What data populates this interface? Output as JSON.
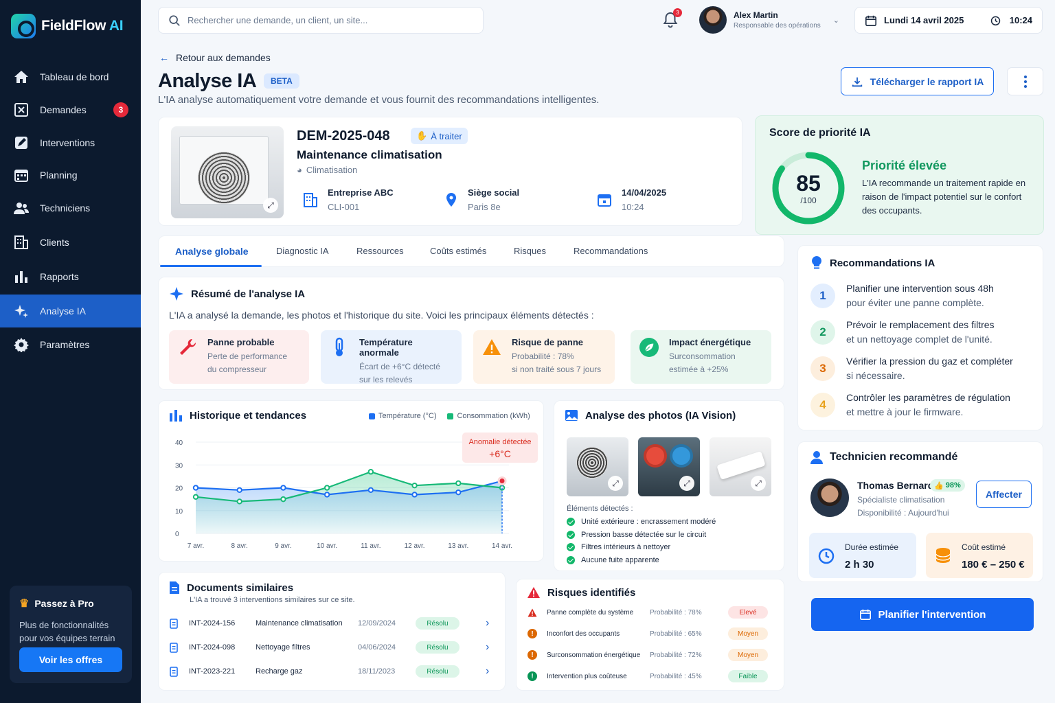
{
  "app": {
    "name_main": "FieldFlow",
    "name_accent": "AI"
  },
  "sidebar": {
    "items": [
      {
        "label": "Tableau de bord",
        "icon": "home-icon"
      },
      {
        "label": "Demandes",
        "icon": "requests-icon",
        "badge": "3"
      },
      {
        "label": "Interventions",
        "icon": "edit-icon"
      },
      {
        "label": "Planning",
        "icon": "calendar-icon"
      },
      {
        "label": "Techniciens",
        "icon": "users-icon"
      },
      {
        "label": "Clients",
        "icon": "building-icon"
      },
      {
        "label": "Rapports",
        "icon": "bar-chart-icon"
      },
      {
        "label": "Analyse IA",
        "icon": "sparkles-icon",
        "active": true
      },
      {
        "label": "Paramètres",
        "icon": "gear-icon"
      }
    ],
    "promo": {
      "title": "Passez à Pro",
      "text": "Plus de fonctionnalités pour vos équipes terrain",
      "button": "Voir les offres"
    }
  },
  "topbar": {
    "search_placeholder": "Rechercher une demande, un client, un site...",
    "notif_count": "3",
    "user_name": "Alex Martin",
    "user_role": "Responsable des opérations",
    "date": "Lundi 14 avril 2025",
    "time": "10:24"
  },
  "header": {
    "back": "Retour aux demandes",
    "title": "Analyse IA",
    "badge": "BETA",
    "subtitle": "L'IA analyse automatiquement votre demande et vous fournit des recommandations intelligentes.",
    "download": "Télécharger le rapport IA"
  },
  "request": {
    "id": "DEM-2025-048",
    "status": "À traiter",
    "name": "Maintenance climatisation",
    "category": "Climatisation",
    "client": "Entreprise ABC",
    "client_id": "CLI-001",
    "site": "Siège social",
    "site_city": "Paris 8e",
    "date": "14/04/2025",
    "time": "10:24"
  },
  "score": {
    "title": "Score de priorité IA",
    "value": "85",
    "max": "/100",
    "fraction": 0.85,
    "level": "Priorité élevée",
    "text": "L'IA recommande un traitement rapide en raison de l'impact potentiel sur le confort des occupants.",
    "color": "#12b76a"
  },
  "tabs": [
    "Analyse globale",
    "Diagnostic IA",
    "Ressources",
    "Coûts estimés",
    "Risques",
    "Recommandations"
  ],
  "summary": {
    "title": "Résumé de l'analyse IA",
    "text": "L'IA a analysé la demande, les photos et l'historique du site. Voici les principaux éléments détectés :",
    "items": [
      {
        "title": "Panne probable",
        "desc1": "Perte de performance",
        "desc2": "du compresseur",
        "color": "#fdeeee"
      },
      {
        "title": "Température anormale",
        "desc1": "Écart de +6°C détecté",
        "desc2": "sur les relevés",
        "color": "#eaf2fd"
      },
      {
        "title": "Risque de panne",
        "desc1": "Probabilité : 78%",
        "desc2": "si non traité sous 7 jours",
        "color": "#fef3e8"
      },
      {
        "title": "Impact énergétique",
        "desc1": "Surconsommation",
        "desc2": "estimée à +25%",
        "color": "#eaf7f0"
      }
    ]
  },
  "history": {
    "title": "Historique et tendances",
    "legend_temp": "Température (°C)",
    "legend_conso": "Consommation (kWh)",
    "anomaly_label": "Anomalie détectée",
    "anomaly_value": "+6°C"
  },
  "chart_data": {
    "type": "line",
    "categories": [
      "7 avr.",
      "8 avr.",
      "9 avr.",
      "10 avr.",
      "11 avr.",
      "12 avr.",
      "13 avr.",
      "14 avr."
    ],
    "yticks": [
      "0",
      "10",
      "20",
      "30",
      "40"
    ],
    "ylim": [
      0,
      40
    ],
    "series": [
      {
        "name": "Température (°C)",
        "values": [
          20,
          19,
          20,
          17,
          19,
          17,
          18,
          23
        ],
        "color": "#1d6ff2"
      },
      {
        "name": "Consommation (kWh)",
        "values": [
          16,
          14,
          15,
          20,
          27,
          21,
          22,
          20
        ],
        "color": "#17b978"
      }
    ],
    "annotation": {
      "x": "14 avr.",
      "text": "Anomalie détectée +6°C"
    }
  },
  "photos": {
    "title": "Analyse des photos (IA Vision)",
    "elements_title": "Éléments détectés :",
    "elements": [
      "Unité extérieure : encrassement modéré",
      "Pression basse détectée sur le circuit",
      "Filtres intérieurs à nettoyer",
      "Aucune fuite apparente"
    ]
  },
  "documents": {
    "title": "Documents similaires",
    "subtitle": "L'IA a trouvé 3 interventions similaires sur ce site.",
    "rows": [
      {
        "id": "INT-2024-156",
        "label": "Maintenance climatisation",
        "date": "12/09/2024",
        "status": "Résolu"
      },
      {
        "id": "INT-2024-098",
        "label": "Nettoyage filtres",
        "date": "04/06/2024",
        "status": "Résolu"
      },
      {
        "id": "INT-2023-221",
        "label": "Recharge gaz",
        "date": "18/11/2023",
        "status": "Résolu"
      }
    ]
  },
  "risks": {
    "title": "Risques identifiés",
    "rows": [
      {
        "label": "Panne complète du système",
        "prob": "Probabilité : 78%",
        "level": "Elevé",
        "bg": "#fde4e4",
        "fg": "#d92d20"
      },
      {
        "label": "Inconfort des occupants",
        "prob": "Probabilité : 65%",
        "level": "Moyen",
        "bg": "#fdeedd",
        "fg": "#dc6803"
      },
      {
        "label": "Surconsommation énergétique",
        "prob": "Probabilité : 72%",
        "level": "Moyen",
        "bg": "#fdeedd",
        "fg": "#dc6803"
      },
      {
        "label": "Intervention plus coûteuse",
        "prob": "Probabilité : 45%",
        "level": "Faible",
        "bg": "#dcf5e8",
        "fg": "#079455"
      }
    ]
  },
  "recommendations": {
    "title": "Recommandations IA",
    "items": [
      {
        "num": "1",
        "l1": "Planifier une intervention sous 48h",
        "l2": "pour éviter une panne complète.",
        "bg": "#e3eefe",
        "fg": "#1d5fc7"
      },
      {
        "num": "2",
        "l1": "Prévoir le remplacement des filtres",
        "l2": "et un nettoyage complet de l'unité.",
        "bg": "#dff5ea",
        "fg": "#12985f"
      },
      {
        "num": "3",
        "l1": "Vérifier la pression du gaz et compléter",
        "l2": "si nécessaire.",
        "bg": "#fdeedd",
        "fg": "#dc6803"
      },
      {
        "num": "4",
        "l1": "Contrôler les paramètres de régulation",
        "l2": "et mettre à jour le firmware.",
        "bg": "#fdf2de",
        "fg": "#e8a11a"
      }
    ]
  },
  "technician": {
    "title": "Technicien recommandé",
    "name": "Thomas Bernard",
    "match": "98%",
    "role": "Spécialiste climatisation",
    "availability": "Disponibilité : Aujourd'hui",
    "assign": "Affecter",
    "duration_label": "Durée estimée",
    "duration": "2 h 30",
    "cost_label": "Coût estimé",
    "cost": "180 € – 250 €"
  },
  "plan_button": "Planifier l'intervention"
}
